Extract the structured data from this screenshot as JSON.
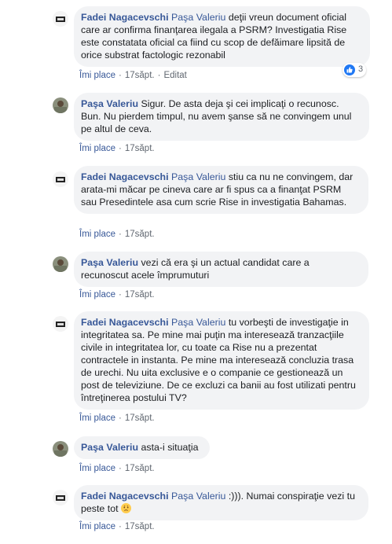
{
  "comments": [
    {
      "author": "Fadei Nagacevschi",
      "mention": "Paşa Valeriu",
      "text": "deţii vreun document oficial care ar confirma finanţarea ilegala a PSRM? Investigatia Rise este constatata oficial ca fiind cu scop de defăimare lipsită de orice substrat factologic rezonabil",
      "like": "Îmi place",
      "time": "17săpt.",
      "edited": "Editat",
      "reactions": "3"
    },
    {
      "author": "Paşa Valeriu",
      "text": "Sigur. De asta deja şi cei implicaţi o recunosc. Bun. Nu pierdem timpul, nu avem şanse să ne convingem unul pe altul de ceva.",
      "like": "Îmi place",
      "time": "17săpt."
    },
    {
      "author": "Fadei Nagacevschi",
      "mention": "Paşa Valeriu",
      "text": "stiu ca nu ne convingem, dar arata-mi măcar pe cineva care ar fi spus ca a finanţat PSRM sau Presedintele asa cum scrie Rise in investigatia Bahamas.",
      "like": "Îmi place",
      "time": "17săpt."
    },
    {
      "author": "Paşa Valeriu",
      "text": "vezi că era şi un actual candidat care a recunoscut acele împrumuturi",
      "like": "Îmi place",
      "time": "17săpt."
    },
    {
      "author": "Fadei Nagacevschi",
      "mention": "Paşa Valeriu",
      "text": "tu vorbeşti de investigaţie in integritatea sa. Pe mine mai puţin ma interesează tranzacţiile civile in integritatea lor, cu toate ca Rise nu a prezentat contractele in instanta. Pe mine ma interesează concluzia trasa de urechi. Nu uita exclusive e o companie ce gestionează un post de televiziune. De ce excluzi ca banii au fost utilizati pentru întreţinerea postului TV?",
      "like": "Îmi place",
      "time": "17săpt."
    },
    {
      "author": "Paşa Valeriu",
      "text": "asta-i situaţia",
      "like": "Îmi place",
      "time": "17săpt."
    },
    {
      "author": "Fadei Nagacevschi",
      "mention": "Paşa Valeriu",
      "text": ":))). Numai conspiraţie vezi tu peste tot",
      "emoji": "disappointed-face",
      "like": "Îmi place",
      "time": "17săpt."
    }
  ],
  "colors": {
    "link": "#385898",
    "bubble": "#f2f3f5",
    "meta": "#606770",
    "like_badge": "#2078f4"
  },
  "icons": {
    "avatar_fadei": "profile-picture-fadei-icon",
    "avatar_pasa": "profile-picture-pasa-icon",
    "reaction": "thumbs-up-icon"
  }
}
